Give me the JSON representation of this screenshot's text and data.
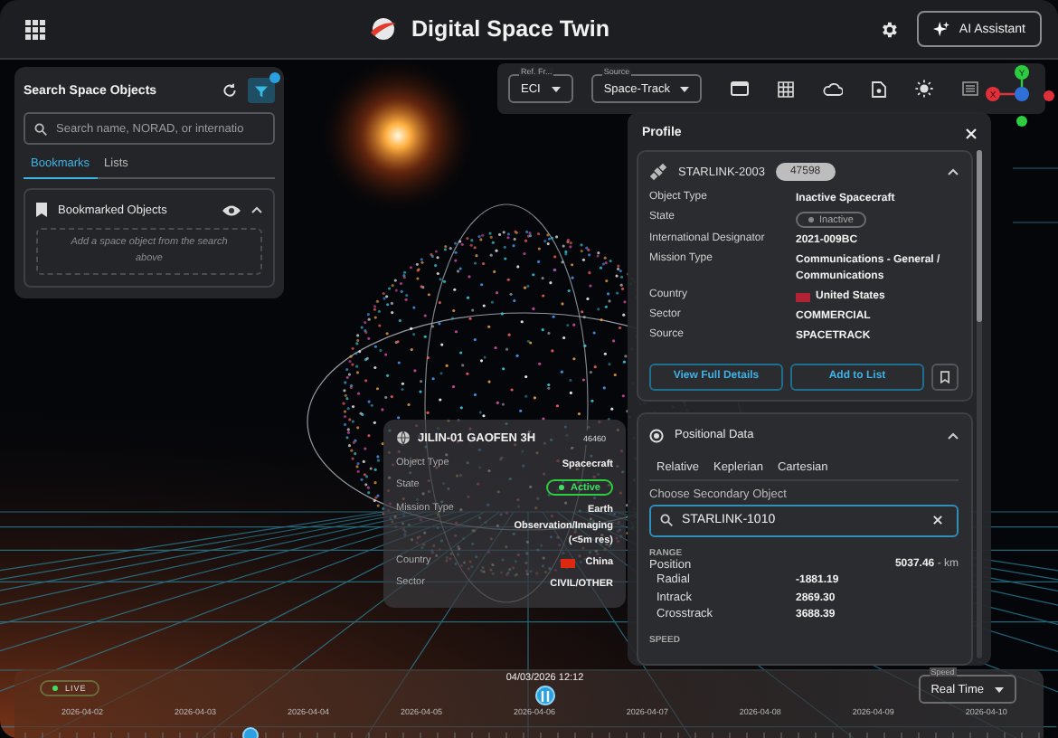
{
  "header": {
    "title": "Digital Space Twin",
    "assistant_button": "AI Assistant"
  },
  "search_panel": {
    "title": "Search Space Objects",
    "search": {
      "placeholder": "Search name, NORAD, or internatio"
    },
    "tabs": [
      {
        "label": "Bookmarks",
        "selected": true
      },
      {
        "label": "Lists",
        "selected": false
      }
    ],
    "bookmarks": {
      "title": "Bookmarked Objects",
      "expanded": true,
      "empty_text": "Add a space object from the search above"
    }
  },
  "toolbar": {
    "ref_frame": {
      "label": "Ref. Fr...",
      "value": "ECI"
    },
    "source": {
      "label": "Source",
      "value": "Space-Track"
    }
  },
  "axes": {
    "y_label": "Y",
    "x_label": "X"
  },
  "profile": {
    "title": "Profile",
    "object": {
      "name": "STARLINK-2003",
      "norad": "47598",
      "expanded": true,
      "fields": [
        {
          "label": "Object Type",
          "value": "Inactive Spacecraft",
          "kind": "text"
        },
        {
          "label": "State",
          "value": "Inactive",
          "kind": "status",
          "active": false
        },
        {
          "label": "International Designator",
          "value": "2021-009BC",
          "kind": "text"
        },
        {
          "label": "Mission Type",
          "value": "Communications - General / Communications",
          "kind": "text"
        },
        {
          "label": "Country",
          "value": "United States",
          "kind": "country",
          "color": "#b22234"
        },
        {
          "label": "Sector",
          "value": "COMMERCIAL",
          "kind": "text"
        },
        {
          "label": "Source",
          "value": "SPACETRACK",
          "kind": "text"
        }
      ],
      "buttons": [
        "View Full Details",
        "Add to List"
      ]
    },
    "positional": {
      "title": "Positional Data",
      "expanded": true,
      "tabs": [
        "Relative",
        "Keplerian",
        "Cartesian"
      ],
      "secondary_label": "Choose Secondary Object",
      "secondary_value": "STARLINK-1010",
      "range_heading": "RANGE",
      "position": {
        "label": "Position",
        "value": "5037.46",
        "unit": "- km"
      },
      "components": [
        {
          "label": "Radial",
          "value": "-1881.19"
        },
        {
          "label": "Intrack",
          "value": "2869.30"
        },
        {
          "label": "Crosstrack",
          "value": "3688.39"
        }
      ],
      "speed_heading": "SPEED"
    }
  },
  "satellite_card": {
    "name": "JILIN-01 GAOFEN 3H",
    "norad": "46460",
    "fields": [
      {
        "label": "Object Type",
        "value": "Spacecraft",
        "kind": "text"
      },
      {
        "label": "State",
        "value": "Active",
        "kind": "status",
        "active": true
      },
      {
        "label": "Mission Type",
        "value": "Earth Observation/Imaging (<5m res)",
        "kind": "text"
      },
      {
        "label": "Country",
        "value": "China",
        "kind": "country",
        "color": "#de2910"
      },
      {
        "label": "Sector",
        "value": "CIVIL/OTHER",
        "kind": "text"
      }
    ]
  },
  "timeline": {
    "live_label": "LIVE",
    "timestamp": "04/03/2026 12:12",
    "speed": {
      "label": "Speed",
      "value": "Real Time"
    },
    "dates": [
      "2026-04-02",
      "2026-04-03",
      "2026-04-04",
      "2026-04-05",
      "2026-04-06",
      "2026-04-07",
      "2026-04-08",
      "2026-04-09",
      "2026-04-10"
    ]
  }
}
